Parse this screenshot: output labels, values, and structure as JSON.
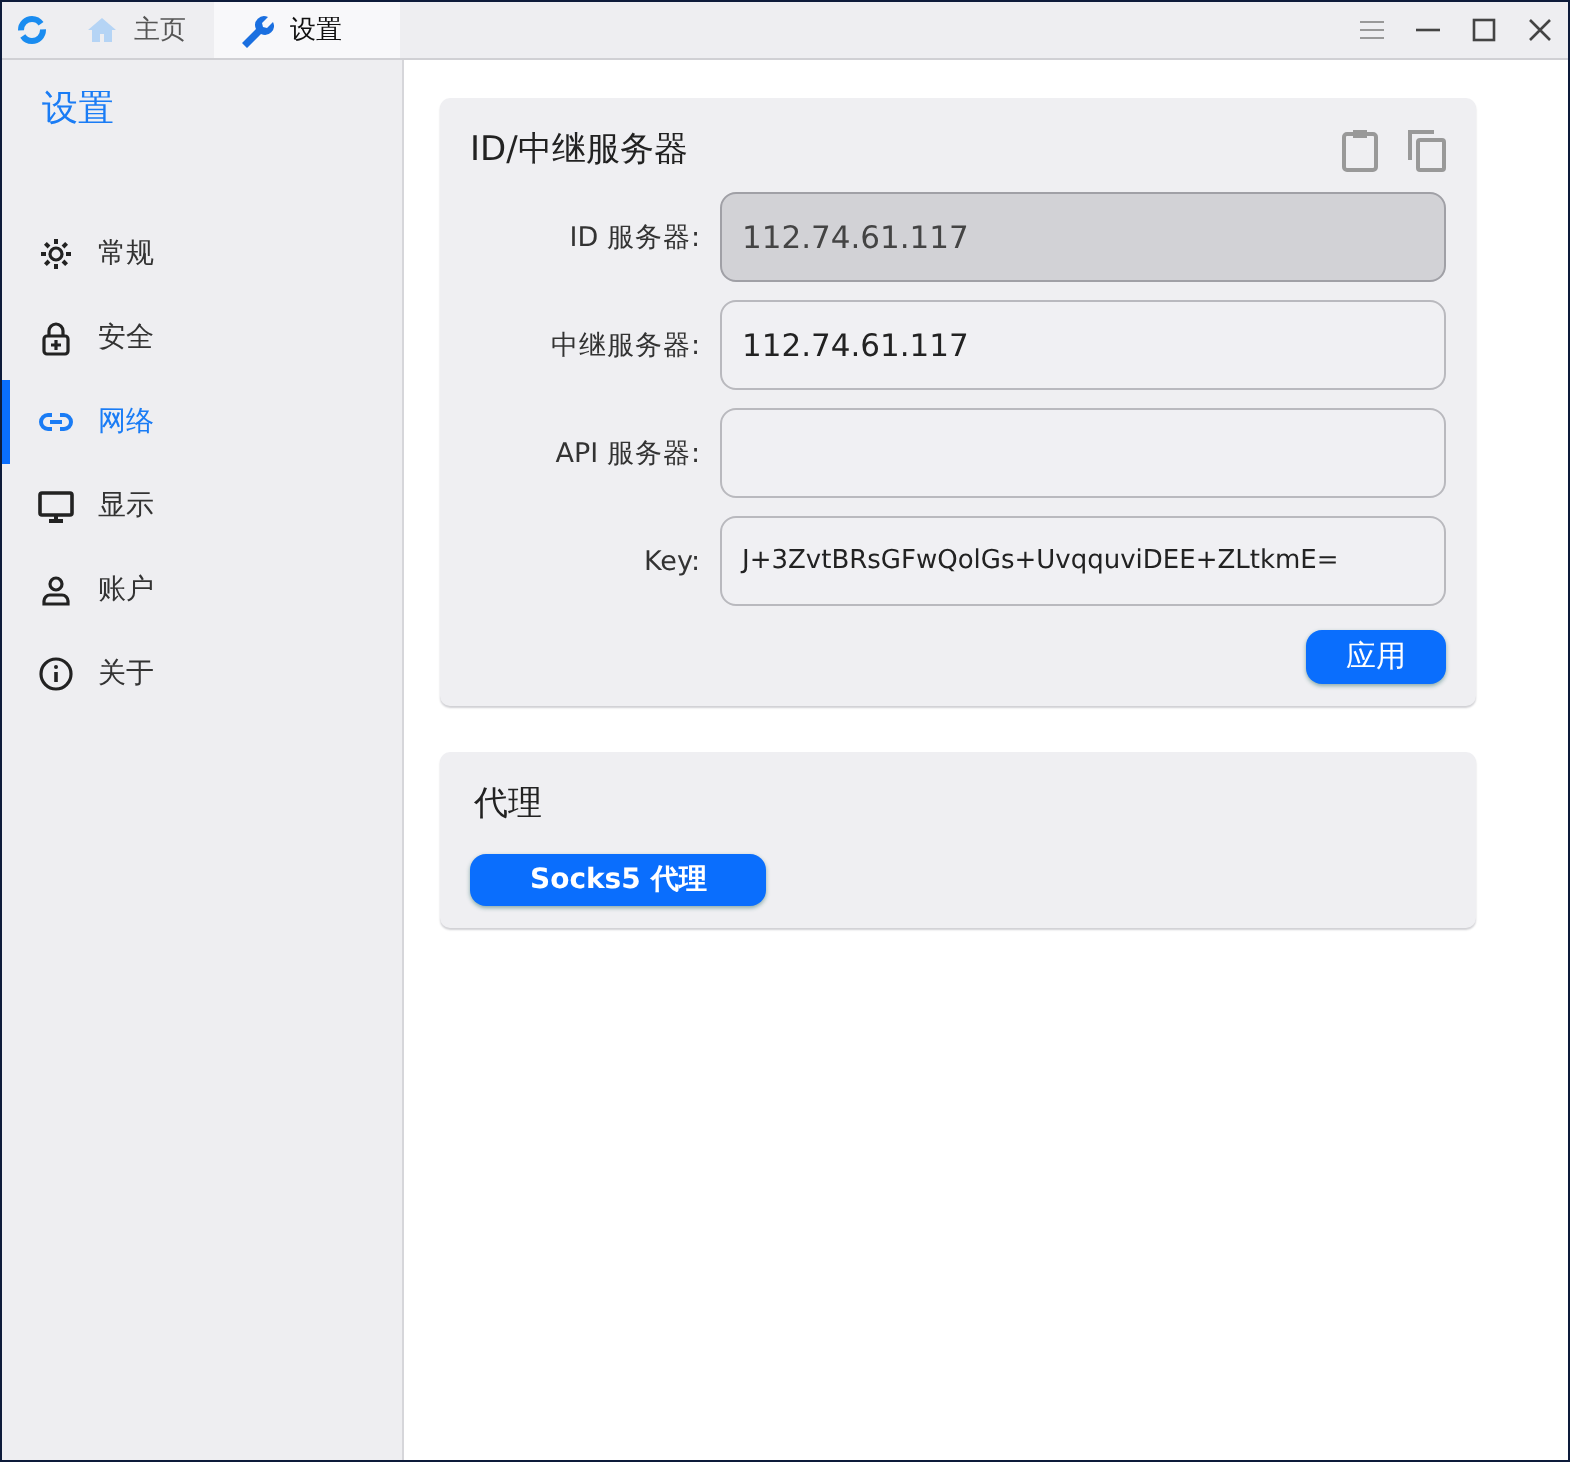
{
  "window": {
    "tabs": [
      {
        "label": "主页",
        "selected": false
      },
      {
        "label": "设置",
        "selected": true
      }
    ]
  },
  "sidebar": {
    "title": "设置",
    "items": [
      {
        "label": "常规",
        "selected": false
      },
      {
        "label": "安全",
        "selected": false
      },
      {
        "label": "网络",
        "selected": true
      },
      {
        "label": "显示",
        "selected": false
      },
      {
        "label": "账户",
        "selected": false
      },
      {
        "label": "关于",
        "selected": false
      }
    ]
  },
  "server_card": {
    "title": "ID/中继服务器",
    "fields": [
      {
        "label": "ID 服务器:",
        "value": "112.74.61.117",
        "disabled": true
      },
      {
        "label": "中继服务器:",
        "value": "112.74.61.117",
        "disabled": false
      },
      {
        "label": "API 服务器:",
        "disabled": false
      },
      {
        "label": "Key:",
        "value": "J+3ZvtBRsGFwQolGs+UvqquviDEE+ZLtkmE=",
        "disabled": false
      }
    ],
    "button": "应用"
  },
  "proxy_card": {
    "title": "代理",
    "button": "Socks5 代理"
  }
}
